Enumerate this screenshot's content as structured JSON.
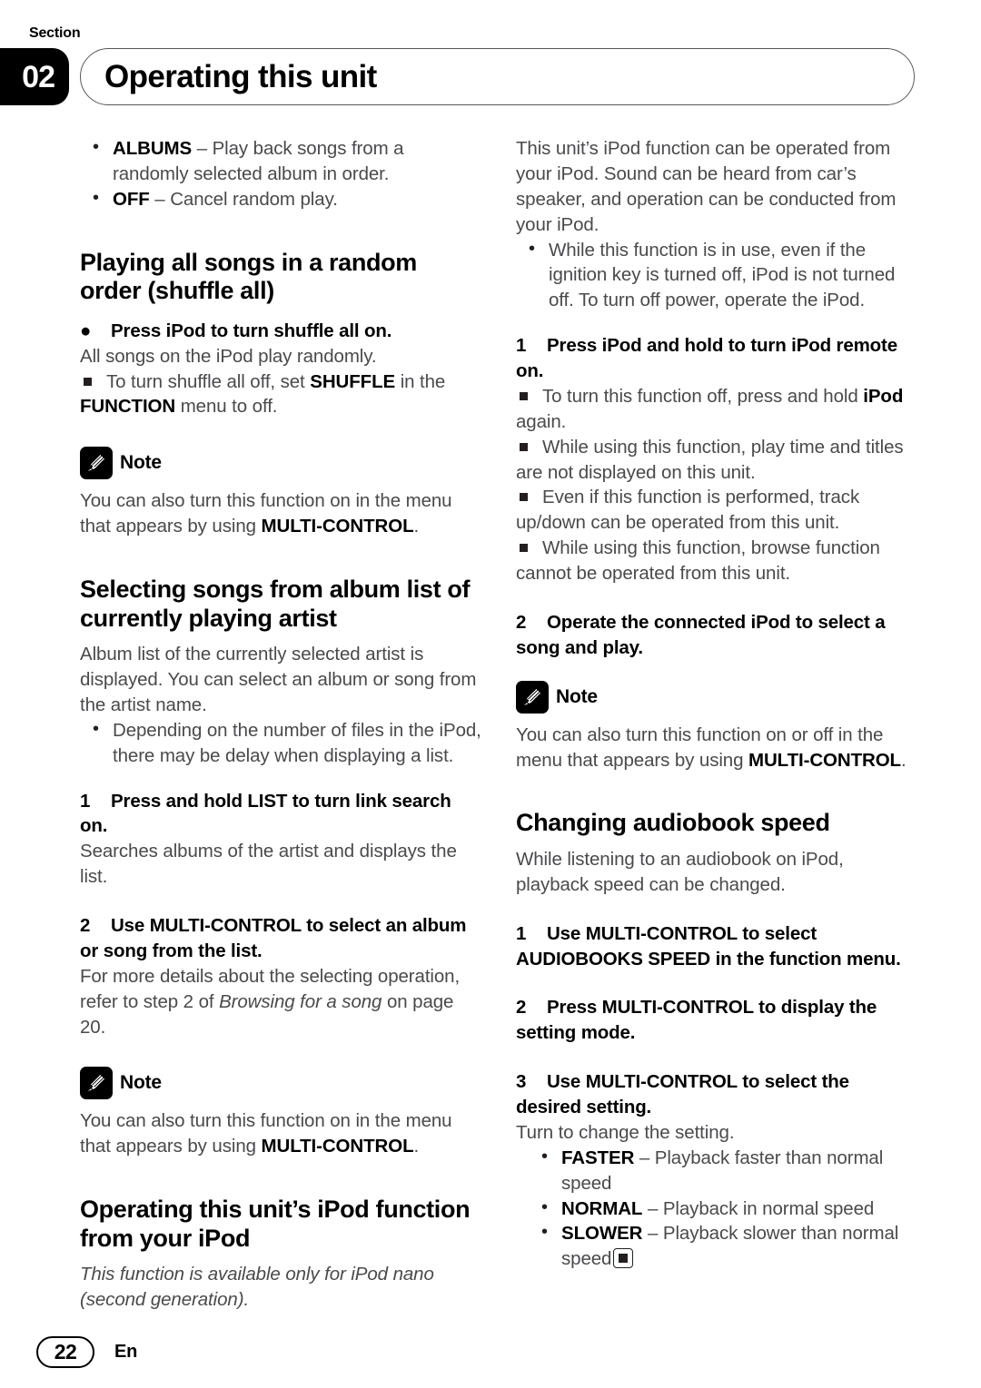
{
  "header": {
    "section_label": "Section",
    "section_number": "02",
    "title": "Operating this unit"
  },
  "footer": {
    "page_number": "22",
    "language": "En"
  },
  "note_label": "Note",
  "left_column": {
    "random_options": [
      {
        "term": "ALBUMS",
        "desc": " – Play back songs from a randomly selected album in order."
      },
      {
        "term": "OFF",
        "desc": " – Cancel random play."
      }
    ],
    "heading_shuffle_all": "Playing all songs in a random order (shuffle all)",
    "shuffle_step": "Press iPod to turn shuffle all on.",
    "shuffle_body": "All songs on the iPod play randomly.",
    "shuffle_square_pre": "To turn shuffle all off, set ",
    "shuffle_square_b1": "SHUFFLE",
    "shuffle_square_mid": " in the ",
    "shuffle_square_b2": "FUNCTION",
    "shuffle_square_post": " menu to off.",
    "note1_pre": "You can also turn this function on in the menu that appears by using ",
    "note1_bold": "MULTI-CONTROL",
    "note1_post": ".",
    "heading_album_list": "Selecting songs from album list of currently playing artist",
    "album_list_body": "Album list of the currently selected artist is displayed. You can select an album or song from the artist name.",
    "album_list_bullet": "Depending on the number of files in the iPod, there may be delay when displaying a list.",
    "step1_num": "1",
    "step1_text": "Press and hold LIST to turn link search on.",
    "step1_body": "Searches albums of the artist and displays the list.",
    "step2_num": "2",
    "step2_text": "Use MULTI-CONTROL to select an album or song from the list.",
    "step2_body_pre": "For more details about the selecting operation, refer to step 2 of ",
    "step2_body_ital": "Browsing for a song",
    "step2_body_post": " on page 20.",
    "note2_pre": "You can also turn this function on in the menu that appears by using ",
    "note2_bold": "MULTI-CONTROL",
    "note2_post": ".",
    "heading_ipod_function": "Operating this unit’s iPod function from your iPod",
    "ipod_function_ital": "This function is available only for iPod nano (second generation)."
  },
  "right_column": {
    "intro": "This unit’s iPod function can be operated from your iPod. Sound can be heard from car’s speaker, and operation can be conducted from your iPod.",
    "intro_bullet": "While this function is in use, even if the ignition key is turned off, iPod is not turned off. To turn off power, operate the iPod.",
    "step1_num": "1",
    "step1_text": "Press iPod and hold to turn iPod remote on.",
    "sq1_pre": "To turn this function off, press and hold ",
    "sq1_bold": "iPod",
    "sq1_post": " again.",
    "sq2": "While using this function, play time and titles are not displayed on this unit.",
    "sq3": "Even if this function is performed, track up/down can be operated from this unit.",
    "sq4": "While using this function, browse function cannot be operated from this unit.",
    "step2_num": "2",
    "step2_text": "Operate the connected iPod to select a song and play.",
    "note_pre": "You can also turn this function on or off in the menu that appears by using ",
    "note_bold": "MULTI-CONTROL",
    "note_post": ".",
    "heading_audiobook": "Changing audiobook speed",
    "audiobook_body": "While listening to an audiobook on iPod, playback speed can be changed.",
    "ab_step1_num": "1",
    "ab_step1_text": "Use MULTI-CONTROL to select AUDIOBOOKS SPEED in the function menu.",
    "ab_step2_num": "2",
    "ab_step2_text": "Press MULTI-CONTROL to display the setting mode.",
    "ab_step3_num": "3",
    "ab_step3_text": "Use MULTI-CONTROL to select the desired setting.",
    "ab_step3_body": "Turn to change the setting.",
    "speed_options": [
      {
        "term": "FASTER",
        "desc": " – Playback faster than normal speed"
      },
      {
        "term": "NORMAL",
        "desc": " – Playback in normal speed"
      },
      {
        "term": "SLOWER",
        "desc": " – Playback slower than normal speed"
      }
    ]
  }
}
